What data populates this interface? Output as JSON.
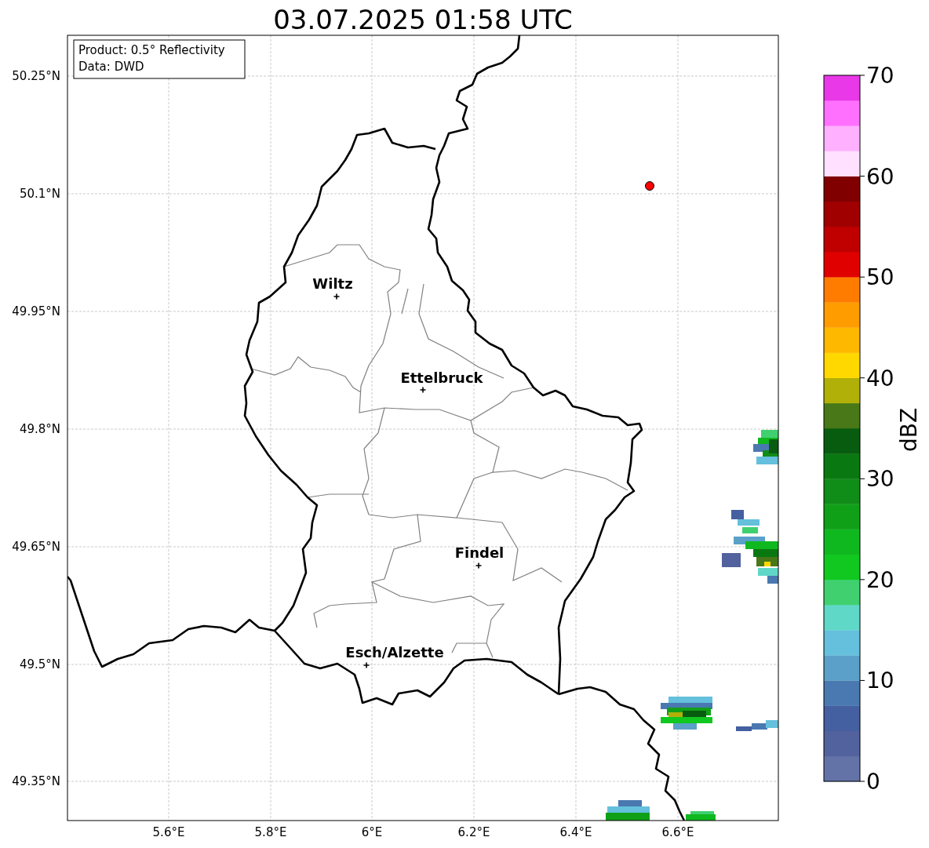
{
  "title": "03.07.2025 01:58 UTC",
  "info_box": {
    "lines": [
      "Product: 0.5° Reflectivity",
      "Data: DWD"
    ]
  },
  "cities": [
    {
      "name": "Wiltz"
    },
    {
      "name": "Ettelbruck"
    },
    {
      "name": "Findel"
    },
    {
      "name": "Esch/Alzette"
    }
  ],
  "x_ticks": [
    "5.6°E",
    "5.8°E",
    "6°E",
    "6.2°E",
    "6.4°E",
    "6.6°E"
  ],
  "y_ticks": [
    "50.25°N",
    "50.1°N",
    "49.95°N",
    "49.8°N",
    "49.65°N",
    "49.5°N",
    "49.35°N"
  ],
  "colorbar": {
    "label": "dBZ",
    "ticks": [
      "70",
      "60",
      "50",
      "40",
      "30",
      "20",
      "10",
      "0"
    ],
    "bins": [
      {
        "color": "#6373a8"
      },
      {
        "color": "#52629e"
      },
      {
        "color": "#4460a0"
      },
      {
        "color": "#4a78b0"
      },
      {
        "color": "#5aa0c8"
      },
      {
        "color": "#64c0dc"
      },
      {
        "color": "#60d8c8"
      },
      {
        "color": "#40d070"
      },
      {
        "color": "#10c820"
      },
      {
        "color": "#10b820"
      },
      {
        "color": "#10a018"
      },
      {
        "color": "#108c18"
      },
      {
        "color": "#0a7810"
      },
      {
        "color": "#085c10"
      },
      {
        "color": "#487818"
      },
      {
        "color": "#b0b008"
      },
      {
        "color": "#ffd800"
      },
      {
        "color": "#ffb800"
      },
      {
        "color": "#ff9c00"
      },
      {
        "color": "#ff7c00"
      },
      {
        "color": "#e00000"
      },
      {
        "color": "#c00000"
      },
      {
        "color": "#a00000"
      },
      {
        "color": "#800000"
      },
      {
        "color": "#ffe0ff"
      },
      {
        "color": "#ffb0ff"
      },
      {
        "color": "#ff70ff"
      },
      {
        "color": "#e838e8"
      }
    ]
  }
}
